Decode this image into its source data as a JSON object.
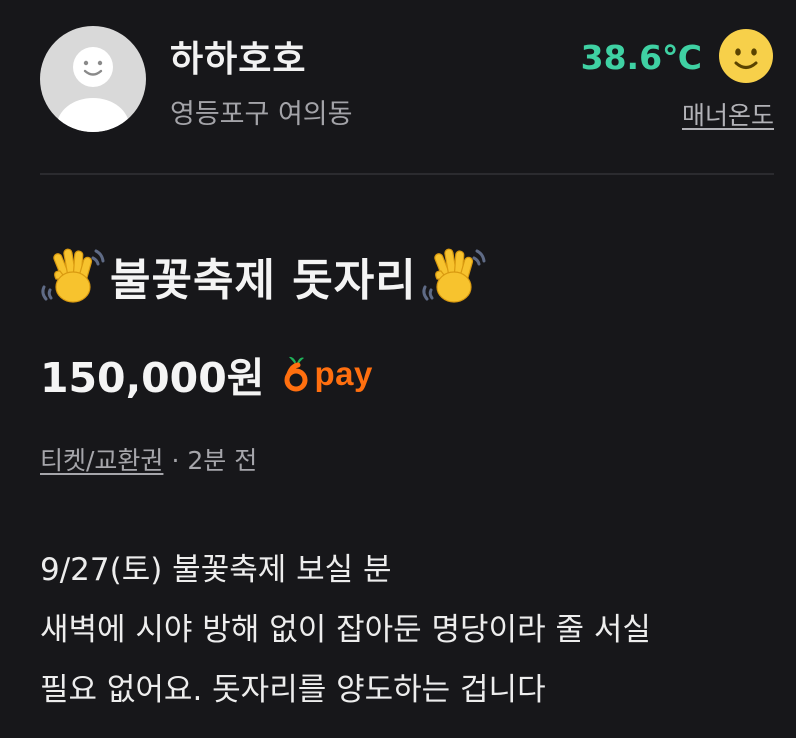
{
  "seller": {
    "nickname": "하하호호",
    "location": "영등포구 여의동",
    "manner_temperature": "38.6℃",
    "manner_label": "매너온도",
    "temperature_icon": "smiling-face-icon"
  },
  "post": {
    "title": "불꽃축제 돗자리",
    "title_emoji": "waving-hand-icon",
    "price": "150,000원",
    "pay_label": "pay",
    "category": "티켓/교환권",
    "separator": "·",
    "posted_ago": "2분 전",
    "description_lines": [
      "9/27(토) 불꽃축제 보실 분",
      "새벽에 시야 방해 없이 잡아둔 명당이라 줄 서실",
      "필요 없어요. 돗자리를 양도하는 겁니다"
    ]
  },
  "colors": {
    "background": "#17171a",
    "temperature": "#3fd1a3",
    "pay_brand": "#ff6f0f",
    "muted_text": "#a6a6ab"
  }
}
